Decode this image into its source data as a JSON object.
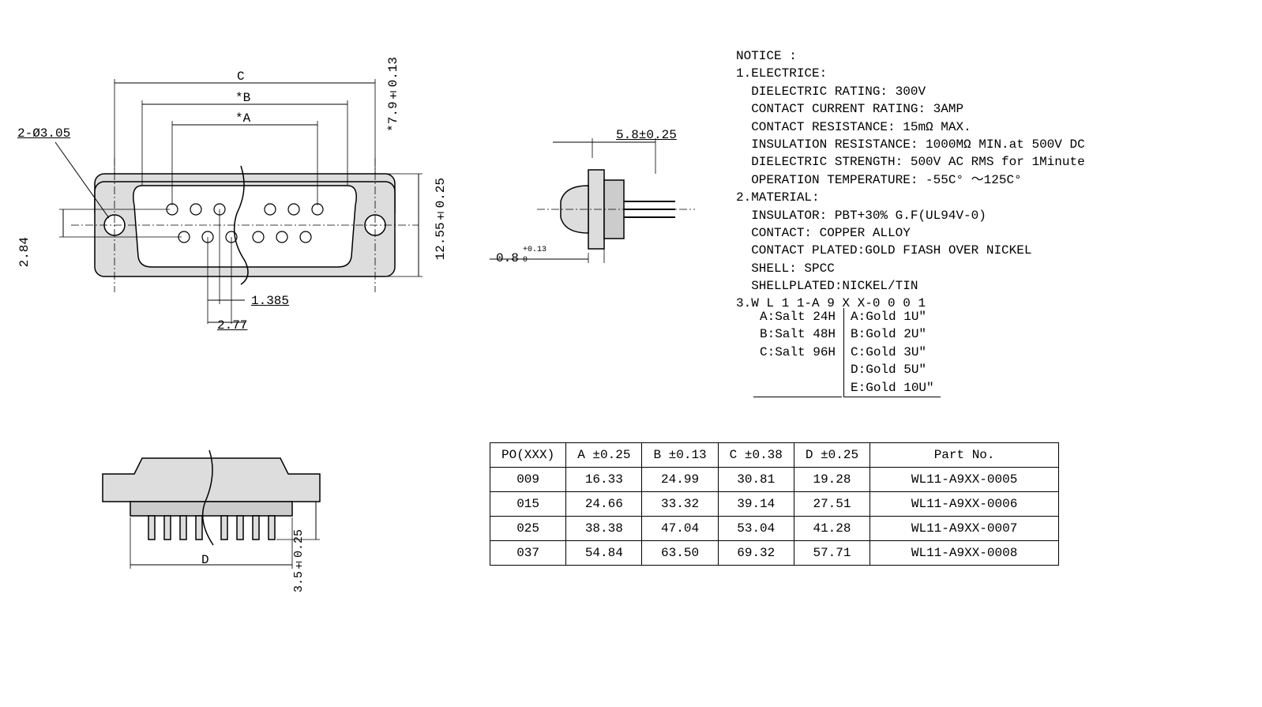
{
  "front_view": {
    "dim_C": "C",
    "dim_B": "*B",
    "dim_A": "*A",
    "h1": "*7.9±0.13",
    "h2": "12.55±0.25",
    "hole": "2-Ø3.05",
    "row_off": "2.84",
    "pitch_half": "1.385",
    "pitch": "2.77"
  },
  "side_view": {
    "top": "5.8±0.25",
    "bot": "0.8",
    "bot_tol": "+0.13",
    "bot_tol2": "0"
  },
  "bottom_view": {
    "dim_D": "D",
    "pin_len": "3.5±0.25"
  },
  "notice": {
    "title": "NOTICE :",
    "l1": "1.ELECTRICE:",
    "l1a": "  DIELECTRIC RATING: 300V",
    "l1b": "  CONTACT CURRENT RATING: 3AMP",
    "l1c": "  CONTACT RESISTANCE: 15mΩ MAX.",
    "l1d": "  INSULATION RESISTANCE: 1000MΩ MIN.at 500V DC",
    "l1e": "  DIELECTRIC STRENGTH: 500V AC RMS for 1Minute",
    "l1f": "  OPERATION TEMPERATURE: -55C° ～125C°",
    "l2": "2.MATERIAL:",
    "l2a": "  INSULATOR: PBT+30% G.F(UL94V-0)",
    "l2b": "  CONTACT: COPPER ALLOY",
    "l2c": "  CONTACT PLATED:GOLD FIASH OVER NICKEL",
    "l2d": "  SHELL: SPCC",
    "l2e": "  SHELLPLATED:NICKEL/TIN",
    "l3": "3.W L 1 1-A 9 X X-0 0 0 1"
  },
  "ordering": {
    "salt": [
      "A:Salt 24H",
      "B:Salt 48H",
      "C:Salt 96H"
    ],
    "gold": [
      "A:Gold 1U\"",
      "B:Gold 2U\"",
      "C:Gold 3U\"",
      "D:Gold 5U\"",
      "E:Gold 10U\""
    ]
  },
  "table": {
    "headers": [
      "PO(XXX)",
      "A ±0.25",
      "B ±0.13",
      "C ±0.38",
      "D ±0.25",
      "Part  No."
    ],
    "rows": [
      [
        "009",
        "16.33",
        "24.99",
        "30.81",
        "19.28",
        "WL11-A9XX-0005"
      ],
      [
        "015",
        "24.66",
        "33.32",
        "39.14",
        "27.51",
        "WL11-A9XX-0006"
      ],
      [
        "025",
        "38.38",
        "47.04",
        "53.04",
        "41.28",
        "WL11-A9XX-0007"
      ],
      [
        "037",
        "54.84",
        "63.50",
        "69.32",
        "57.71",
        "WL11-A9XX-0008"
      ]
    ]
  }
}
